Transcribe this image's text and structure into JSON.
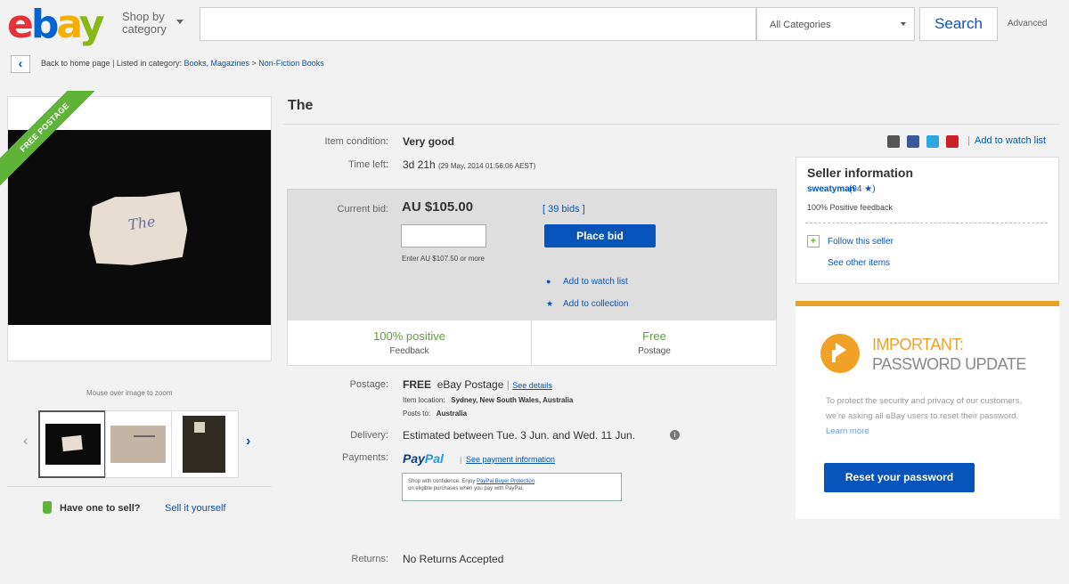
{
  "header": {
    "logo": {
      "e": "e",
      "b": "b",
      "a": "a",
      "y": "y"
    },
    "shop_by": "Shop by",
    "category": "category",
    "search_placeholder": "",
    "category_select": "All Categories",
    "search_button": "Search",
    "advanced": "Advanced"
  },
  "breadcrumb": {
    "back": "Back to home page",
    "listed_in": " | Listed in category: ",
    "path_1": "Books, Magazines",
    "sep": " > ",
    "path_2": "Non-Fiction Books"
  },
  "gallery": {
    "ribbon": "FREE POSTAGE",
    "photo_text": "The",
    "zoom_hint": "Mouse over image to zoom"
  },
  "sell": {
    "question": "Have one to sell?",
    "link": "Sell it yourself"
  },
  "item": {
    "title": "The",
    "condition_label": "Item condition:",
    "condition": "Very good",
    "time_left_label": "Time left:",
    "time_left": "3d 21h",
    "time_left_detail": "(29 May, 2014   01:56:06 AEST)",
    "current_bid_label": "Current bid:",
    "current_bid": "AU $105.00",
    "bids": "[ 39 bids ]",
    "enter_hint": "Enter AU $107.50 or more",
    "place_bid": "Place bid",
    "watch": "Add to watch list",
    "collection": "Add to collection",
    "feedback_value": "100% positive",
    "feedback_label": "Feedback",
    "postage_value": "Free",
    "postage_label": "Postage"
  },
  "shipping": {
    "postage_label": "Postage:",
    "postage_free": "FREE",
    "postage_text": "eBay Postage",
    "see_details": "See details",
    "item_location_label": "Item location:",
    "item_location": "Sydney, New South Wales, Australia",
    "posts_to_label": "Posts to:",
    "posts_to": "Australia",
    "delivery_label": "Delivery:",
    "delivery": "Estimated between Tue. 3 Jun. and Wed. 11 Jun.",
    "payments_label": "Payments:",
    "paypal_pay": "Pay",
    "paypal_pal": "Pal",
    "payment_info": "See payment information",
    "protection_1": "Shop with confidence. Enjoy ",
    "protection_link": "PayPal Buyer Protection",
    "protection_2": "on eligible purchases when you pay with PayPal.",
    "returns_label": "Returns:",
    "returns": "No Returns Accepted"
  },
  "seller": {
    "watch_list": "Add to watch list",
    "title": "Seller information",
    "name": "sweatyman",
    "score": "(94 ★)",
    "feedback": "100% Positive feedback",
    "follow": "Follow this seller",
    "other_items": "See other items"
  },
  "promo": {
    "heading_1": "IMPORTANT:",
    "heading_2": "PASSWORD UPDATE",
    "body": "To protect the security and privacy of our customers, we're asking all eBay users to reset their password. ",
    "learn_more": "Learn more",
    "button": "Reset your password"
  },
  "colors": {
    "accent_blue": "#0654ba",
    "positive_green": "#5ea13d",
    "promo_orange": "#f0a126"
  }
}
